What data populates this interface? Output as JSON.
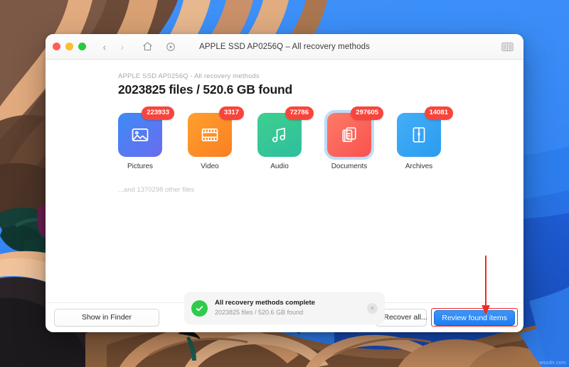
{
  "window": {
    "title": "APPLE SSD AP0256Q – All recovery methods",
    "traffic_lights": [
      "close",
      "minimize",
      "zoom"
    ],
    "toolbar": {
      "back_label": "‹",
      "forward_label": "›",
      "home_icon": "home-icon",
      "play_icon": "play-circle-icon",
      "panel_icon": "sidebar-toggle-icon"
    }
  },
  "main": {
    "subheading": "APPLE SSD AP0256Q - All recovery methods",
    "headline": "2023825 files / 520.6 GB found",
    "other_files": "...and 1370298 other files",
    "categories": [
      {
        "label": "Pictures",
        "count": "223933",
        "icon": "image-icon",
        "color": "#4a87f2",
        "selected": false
      },
      {
        "label": "Video",
        "count": "3317",
        "icon": "film-icon",
        "color": "#fb8f28",
        "selected": false
      },
      {
        "label": "Audio",
        "count": "72786",
        "icon": "music-icon",
        "color": "#35c796",
        "selected": false
      },
      {
        "label": "Documents",
        "count": "297605",
        "icon": "document-icon",
        "color": "#fb685b",
        "selected": true
      },
      {
        "label": "Archives",
        "count": "14081",
        "icon": "archive-icon",
        "color": "#37a5f3",
        "selected": false
      }
    ]
  },
  "toast": {
    "icon": "check-circle-icon",
    "title": "All recovery methods complete",
    "subtitle": "2023825 files / 520.6 GB found",
    "close_label": "×"
  },
  "bottom_bar": {
    "show_in_finder": "Show in Finder",
    "recover_all": "Recover all...",
    "review_found_items": "Review found items"
  },
  "annotation": {
    "arrow": "down-arrow-annotation",
    "highlight_color": "#ee2b24"
  },
  "watermark": "wsxdn.com",
  "colors": {
    "accent_blue": "#1d7ef2",
    "badge_red": "#f8453b",
    "success_green": "#2ecc4a",
    "selection_blue": "#bcdcfb"
  }
}
